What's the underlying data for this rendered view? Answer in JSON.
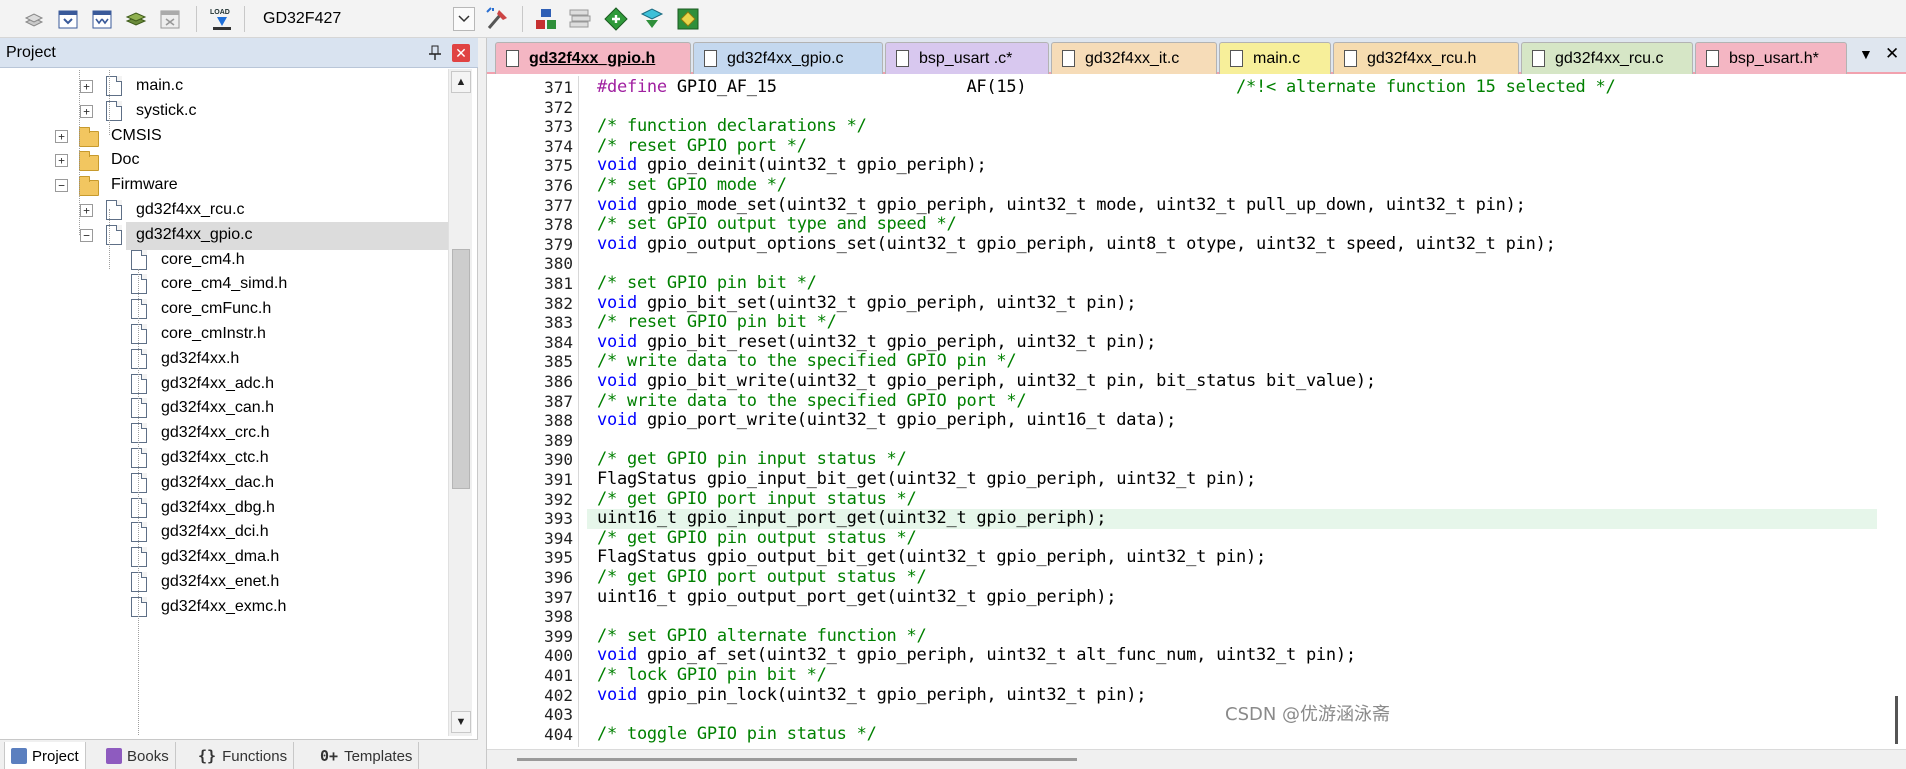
{
  "toolbar": {
    "target": "GD32F427",
    "icons": [
      "translate-icon",
      "build-icon",
      "rebuild-icon",
      "batch-build-icon",
      "stop-build-icon",
      "load-icon",
      "target-options-icon",
      "manage-components-icon",
      "file-extensions-icon",
      "select-pack-icon",
      "pack-installer-icon",
      "manage-runtime-icon"
    ],
    "load_label": "LOAD"
  },
  "project": {
    "title": "Project",
    "tree": [
      {
        "label": "main.c",
        "type": "file-expandable"
      },
      {
        "label": "systick.c",
        "type": "file-expandable"
      },
      {
        "label": "CMSIS",
        "type": "folder"
      },
      {
        "label": "Doc",
        "type": "folder"
      },
      {
        "label": "Firmware",
        "type": "folder-open"
      },
      {
        "label": "gd32f4xx_rcu.c",
        "type": "file-expandable"
      },
      {
        "label": "gd32f4xx_gpio.c",
        "type": "file-open"
      },
      {
        "label": "core_cm4.h",
        "type": "file"
      },
      {
        "label": "core_cm4_simd.h",
        "type": "file"
      },
      {
        "label": "core_cmFunc.h",
        "type": "file"
      },
      {
        "label": "core_cmInstr.h",
        "type": "file"
      },
      {
        "label": "gd32f4xx.h",
        "type": "file"
      },
      {
        "label": "gd32f4xx_adc.h",
        "type": "file"
      },
      {
        "label": "gd32f4xx_can.h",
        "type": "file"
      },
      {
        "label": "gd32f4xx_crc.h",
        "type": "file"
      },
      {
        "label": "gd32f4xx_ctc.h",
        "type": "file"
      },
      {
        "label": "gd32f4xx_dac.h",
        "type": "file"
      },
      {
        "label": "gd32f4xx_dbg.h",
        "type": "file"
      },
      {
        "label": "gd32f4xx_dci.h",
        "type": "file"
      },
      {
        "label": "gd32f4xx_dma.h",
        "type": "file"
      },
      {
        "label": "gd32f4xx_enet.h",
        "type": "file"
      },
      {
        "label": "gd32f4xx_exmc.h",
        "type": "file"
      }
    ],
    "bottom_tabs": [
      {
        "label": "Project",
        "color": "#5b7fbf"
      },
      {
        "label": "Books",
        "color": "#8e5bbf"
      },
      {
        "label": "Functions",
        "prefix": "{}"
      },
      {
        "label": "Templates",
        "prefix": "0+"
      }
    ]
  },
  "editor": {
    "tabs": [
      {
        "label": "gd32f4xx_gpio.h",
        "color": "#f4b6c3",
        "active": true
      },
      {
        "label": "gd32f4xx_gpio.c",
        "color": "#c4d8ef"
      },
      {
        "label": "bsp_usart .c*",
        "color": "#d8c8ef"
      },
      {
        "label": "gd32f4xx_it.c",
        "color": "#f6dcb8"
      },
      {
        "label": "main.c",
        "color": "#f7ef9a"
      },
      {
        "label": "gd32f4xx_rcu.h",
        "color": "#f6dcb0"
      },
      {
        "label": "gd32f4xx_rcu.c",
        "color": "#d6e6c6"
      },
      {
        "label": "bsp_usart.h*",
        "color": "#f4b6c3"
      }
    ],
    "tab_menu": "▼",
    "tab_close": "✕",
    "current_line": 393,
    "lines": [
      {
        "n": "371",
        "text": "#define GPIO_AF_15                   AF(15)                     /*!< alternate function 15 selected */"
      },
      {
        "n": "372",
        "text": ""
      },
      {
        "n": "373",
        "text": "/* function declarations */"
      },
      {
        "n": "374",
        "text": "/* reset GPIO port */"
      },
      {
        "n": "375",
        "text": "void gpio_deinit(uint32_t gpio_periph);"
      },
      {
        "n": "376",
        "text": "/* set GPIO mode */"
      },
      {
        "n": "377",
        "text": "void gpio_mode_set(uint32_t gpio_periph, uint32_t mode, uint32_t pull_up_down, uint32_t pin);"
      },
      {
        "n": "378",
        "text": "/* set GPIO output type and speed */"
      },
      {
        "n": "379",
        "text": "void gpio_output_options_set(uint32_t gpio_periph, uint8_t otype, uint32_t speed, uint32_t pin);"
      },
      {
        "n": "380",
        "text": ""
      },
      {
        "n": "381",
        "text": "/* set GPIO pin bit */"
      },
      {
        "n": "382",
        "text": "void gpio_bit_set(uint32_t gpio_periph, uint32_t pin);"
      },
      {
        "n": "383",
        "text": "/* reset GPIO pin bit */"
      },
      {
        "n": "384",
        "text": "void gpio_bit_reset(uint32_t gpio_periph, uint32_t pin);"
      },
      {
        "n": "385",
        "text": "/* write data to the specified GPIO pin */"
      },
      {
        "n": "386",
        "text": "void gpio_bit_write(uint32_t gpio_periph, uint32_t pin, bit_status bit_value);"
      },
      {
        "n": "387",
        "text": "/* write data to the specified GPIO port */"
      },
      {
        "n": "388",
        "text": "void gpio_port_write(uint32_t gpio_periph, uint16_t data);"
      },
      {
        "n": "389",
        "text": ""
      },
      {
        "n": "390",
        "text": "/* get GPIO pin input status */"
      },
      {
        "n": "391",
        "text": "FlagStatus gpio_input_bit_get(uint32_t gpio_periph, uint32_t pin);"
      },
      {
        "n": "392",
        "text": "/* get GPIO port input status */"
      },
      {
        "n": "393",
        "text": "uint16_t gpio_input_port_get(uint32_t gpio_periph);"
      },
      {
        "n": "394",
        "text": "/* get GPIO pin output status */"
      },
      {
        "n": "395",
        "text": "FlagStatus gpio_output_bit_get(uint32_t gpio_periph, uint32_t pin);"
      },
      {
        "n": "396",
        "text": "/* get GPIO port output status */"
      },
      {
        "n": "397",
        "text": "uint16_t gpio_output_port_get(uint32_t gpio_periph);"
      },
      {
        "n": "398",
        "text": ""
      },
      {
        "n": "399",
        "text": "/* set GPIO alternate function */"
      },
      {
        "n": "400",
        "text": "void gpio_af_set(uint32_t gpio_periph, uint32_t alt_func_num, uint32_t pin);"
      },
      {
        "n": "401",
        "text": "/* lock GPIO pin bit */"
      },
      {
        "n": "402",
        "text": "void gpio_pin_lock(uint32_t gpio_periph, uint32_t pin);"
      },
      {
        "n": "403",
        "text": ""
      },
      {
        "n": "404",
        "text": "/* toggle GPIO pin status */"
      }
    ]
  },
  "watermark": "CSDN @优游涵泳斋"
}
